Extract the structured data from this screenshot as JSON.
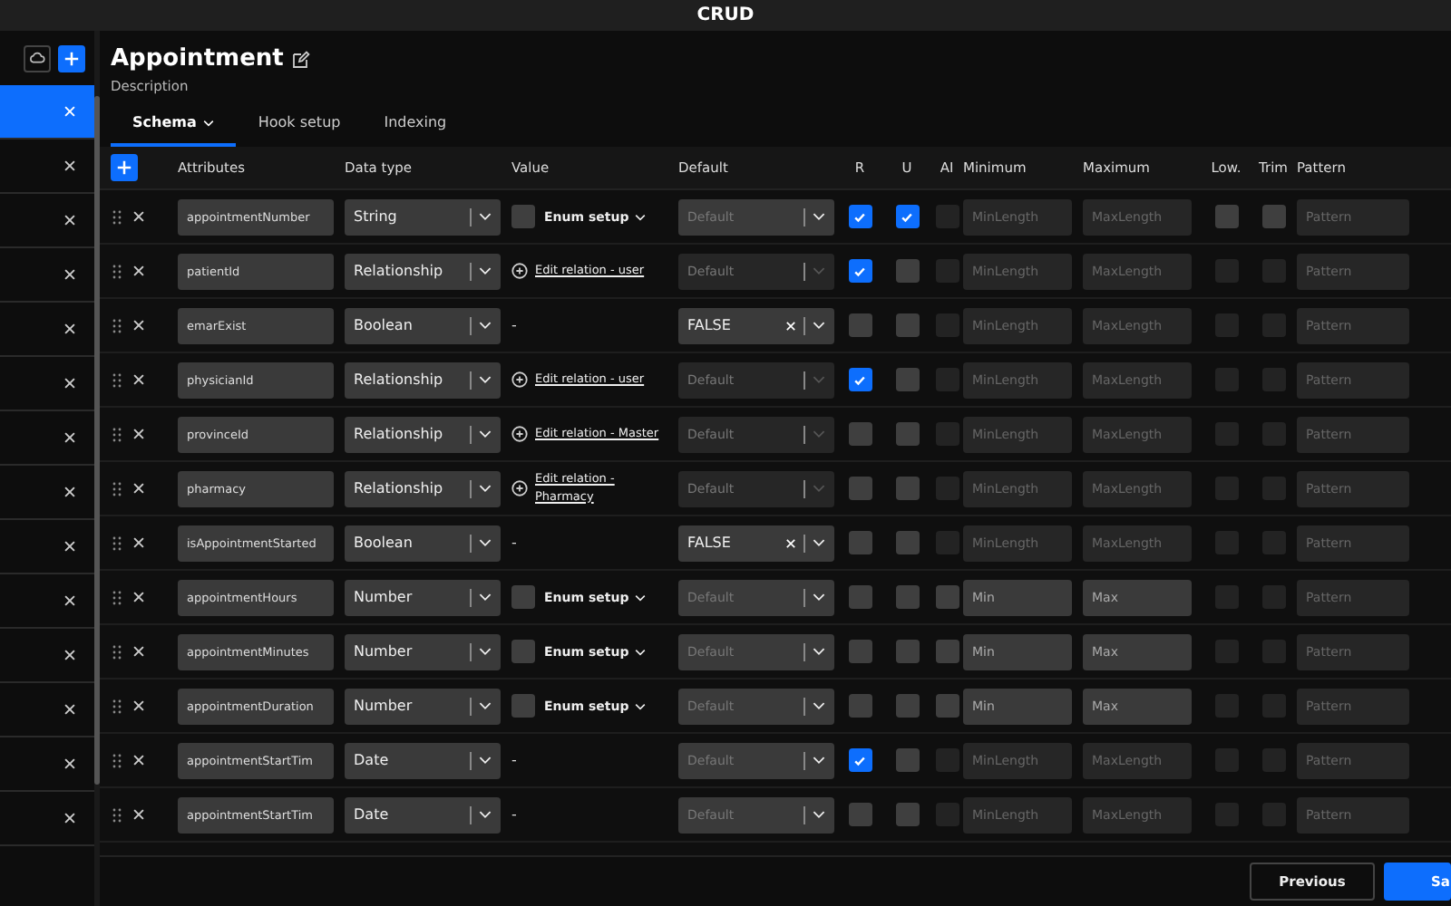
{
  "window": {
    "title": "CRUD"
  },
  "sidebar": {
    "items": [
      {
        "selected": true
      },
      {
        "selected": false
      },
      {
        "selected": false
      },
      {
        "selected": false
      },
      {
        "selected": false
      },
      {
        "selected": false
      },
      {
        "selected": false
      },
      {
        "selected": false
      },
      {
        "selected": false
      },
      {
        "selected": false
      },
      {
        "selected": false
      },
      {
        "selected": false
      },
      {
        "selected": false
      },
      {
        "selected": false
      }
    ]
  },
  "header": {
    "title": "Appointment",
    "description": "Description"
  },
  "tabs": [
    {
      "label": "Schema",
      "selected": true,
      "has_menu": true
    },
    {
      "label": "Hook setup",
      "selected": false,
      "has_menu": false
    },
    {
      "label": "Indexing",
      "selected": false,
      "has_menu": false
    }
  ],
  "table": {
    "columns": [
      "Attributes",
      "Data type",
      "Value",
      "Default",
      "R",
      "U",
      "AI",
      "Minimum",
      "Maximum",
      "Low.",
      "Trim",
      "Pattern"
    ],
    "rows": [
      {
        "name": "appointmentNumber",
        "type": "String",
        "value": {
          "kind": "enum",
          "text": "Enum setup",
          "checked": false
        },
        "default": {
          "kind": "placeholder",
          "text": "Default",
          "disabled": false
        },
        "r": {
          "checked": true,
          "disabled": false
        },
        "u": {
          "checked": true,
          "disabled": false
        },
        "ai": {
          "checked": false,
          "disabled": true
        },
        "min": {
          "placeholder": "MinLength",
          "disabled": true
        },
        "max": {
          "placeholder": "MaxLength",
          "disabled": true
        },
        "low": {
          "checked": false,
          "disabled": false
        },
        "trim": {
          "checked": false,
          "disabled": false
        },
        "pattern": {
          "placeholder": "Pattern"
        }
      },
      {
        "name": "patientId",
        "type": "Relationship",
        "value": {
          "kind": "relation",
          "text": "Edit relation - user"
        },
        "default": {
          "kind": "placeholder",
          "text": "Default",
          "disabled": true
        },
        "r": {
          "checked": true,
          "disabled": false
        },
        "u": {
          "checked": false,
          "disabled": false
        },
        "ai": {
          "checked": false,
          "disabled": true
        },
        "min": {
          "placeholder": "MinLength",
          "disabled": true
        },
        "max": {
          "placeholder": "MaxLength",
          "disabled": true
        },
        "low": {
          "checked": false,
          "disabled": true
        },
        "trim": {
          "checked": false,
          "disabled": true
        },
        "pattern": {
          "placeholder": "Pattern"
        }
      },
      {
        "name": "emarExist",
        "type": "Boolean",
        "value": {
          "kind": "none",
          "text": "-"
        },
        "default": {
          "kind": "value",
          "text": "FALSE",
          "disabled": false
        },
        "r": {
          "checked": false,
          "disabled": false
        },
        "u": {
          "checked": false,
          "disabled": false
        },
        "ai": {
          "checked": false,
          "disabled": true
        },
        "min": {
          "placeholder": "MinLength",
          "disabled": true
        },
        "max": {
          "placeholder": "MaxLength",
          "disabled": true
        },
        "low": {
          "checked": false,
          "disabled": true
        },
        "trim": {
          "checked": false,
          "disabled": true
        },
        "pattern": {
          "placeholder": "Pattern"
        }
      },
      {
        "name": "physicianId",
        "type": "Relationship",
        "value": {
          "kind": "relation",
          "text": "Edit relation - user"
        },
        "default": {
          "kind": "placeholder",
          "text": "Default",
          "disabled": true
        },
        "r": {
          "checked": true,
          "disabled": false
        },
        "u": {
          "checked": false,
          "disabled": false
        },
        "ai": {
          "checked": false,
          "disabled": true
        },
        "min": {
          "placeholder": "MinLength",
          "disabled": true
        },
        "max": {
          "placeholder": "MaxLength",
          "disabled": true
        },
        "low": {
          "checked": false,
          "disabled": true
        },
        "trim": {
          "checked": false,
          "disabled": true
        },
        "pattern": {
          "placeholder": "Pattern"
        }
      },
      {
        "name": "provinceId",
        "type": "Relationship",
        "value": {
          "kind": "relation",
          "text": "Edit relation - Master"
        },
        "default": {
          "kind": "placeholder",
          "text": "Default",
          "disabled": true
        },
        "r": {
          "checked": false,
          "disabled": false
        },
        "u": {
          "checked": false,
          "disabled": false
        },
        "ai": {
          "checked": false,
          "disabled": true
        },
        "min": {
          "placeholder": "MinLength",
          "disabled": true
        },
        "max": {
          "placeholder": "MaxLength",
          "disabled": true
        },
        "low": {
          "checked": false,
          "disabled": true
        },
        "trim": {
          "checked": false,
          "disabled": true
        },
        "pattern": {
          "placeholder": "Pattern"
        }
      },
      {
        "name": "pharmacy",
        "type": "Relationship",
        "value": {
          "kind": "relation",
          "text": "Edit relation - Pharmacy"
        },
        "default": {
          "kind": "placeholder",
          "text": "Default",
          "disabled": true
        },
        "r": {
          "checked": false,
          "disabled": false
        },
        "u": {
          "checked": false,
          "disabled": false
        },
        "ai": {
          "checked": false,
          "disabled": true
        },
        "min": {
          "placeholder": "MinLength",
          "disabled": true
        },
        "max": {
          "placeholder": "MaxLength",
          "disabled": true
        },
        "low": {
          "checked": false,
          "disabled": true
        },
        "trim": {
          "checked": false,
          "disabled": true
        },
        "pattern": {
          "placeholder": "Pattern"
        }
      },
      {
        "name": "isAppointmentStarted",
        "type": "Boolean",
        "value": {
          "kind": "none",
          "text": "-"
        },
        "default": {
          "kind": "value",
          "text": "FALSE",
          "disabled": false
        },
        "r": {
          "checked": false,
          "disabled": false
        },
        "u": {
          "checked": false,
          "disabled": false
        },
        "ai": {
          "checked": false,
          "disabled": true
        },
        "min": {
          "placeholder": "MinLength",
          "disabled": true
        },
        "max": {
          "placeholder": "MaxLength",
          "disabled": true
        },
        "low": {
          "checked": false,
          "disabled": true
        },
        "trim": {
          "checked": false,
          "disabled": true
        },
        "pattern": {
          "placeholder": "Pattern"
        }
      },
      {
        "name": "appointmentHours",
        "type": "Number",
        "value": {
          "kind": "enum",
          "text": "Enum setup",
          "checked": false
        },
        "default": {
          "kind": "placeholder",
          "text": "Default",
          "disabled": false
        },
        "r": {
          "checked": false,
          "disabled": false
        },
        "u": {
          "checked": false,
          "disabled": false
        },
        "ai": {
          "checked": false,
          "disabled": false
        },
        "min": {
          "placeholder": "Min",
          "disabled": false
        },
        "max": {
          "placeholder": "Max",
          "disabled": false
        },
        "low": {
          "checked": false,
          "disabled": true
        },
        "trim": {
          "checked": false,
          "disabled": true
        },
        "pattern": {
          "placeholder": "Pattern"
        }
      },
      {
        "name": "appointmentMinutes",
        "type": "Number",
        "value": {
          "kind": "enum",
          "text": "Enum setup",
          "checked": false
        },
        "default": {
          "kind": "placeholder",
          "text": "Default",
          "disabled": false
        },
        "r": {
          "checked": false,
          "disabled": false
        },
        "u": {
          "checked": false,
          "disabled": false
        },
        "ai": {
          "checked": false,
          "disabled": false
        },
        "min": {
          "placeholder": "Min",
          "disabled": false
        },
        "max": {
          "placeholder": "Max",
          "disabled": false
        },
        "low": {
          "checked": false,
          "disabled": true
        },
        "trim": {
          "checked": false,
          "disabled": true
        },
        "pattern": {
          "placeholder": "Pattern"
        }
      },
      {
        "name": "appointmentDuration",
        "type": "Number",
        "value": {
          "kind": "enum",
          "text": "Enum setup",
          "checked": false
        },
        "default": {
          "kind": "placeholder",
          "text": "Default",
          "disabled": false
        },
        "r": {
          "checked": false,
          "disabled": false
        },
        "u": {
          "checked": false,
          "disabled": false
        },
        "ai": {
          "checked": false,
          "disabled": false
        },
        "min": {
          "placeholder": "Min",
          "disabled": false
        },
        "max": {
          "placeholder": "Max",
          "disabled": false
        },
        "low": {
          "checked": false,
          "disabled": true
        },
        "trim": {
          "checked": false,
          "disabled": true
        },
        "pattern": {
          "placeholder": "Pattern"
        }
      },
      {
        "name": "appointmentStartTim",
        "type": "Date",
        "value": {
          "kind": "none",
          "text": "-"
        },
        "default": {
          "kind": "placeholder",
          "text": "Default",
          "disabled": false
        },
        "r": {
          "checked": true,
          "disabled": false
        },
        "u": {
          "checked": false,
          "disabled": false
        },
        "ai": {
          "checked": false,
          "disabled": true
        },
        "min": {
          "placeholder": "MinLength",
          "disabled": true
        },
        "max": {
          "placeholder": "MaxLength",
          "disabled": true
        },
        "low": {
          "checked": false,
          "disabled": true
        },
        "trim": {
          "checked": false,
          "disabled": true
        },
        "pattern": {
          "placeholder": "Pattern"
        }
      },
      {
        "name": "appointmentStartTim",
        "type": "Date",
        "value": {
          "kind": "none",
          "text": "-"
        },
        "default": {
          "kind": "placeholder",
          "text": "Default",
          "disabled": false
        },
        "r": {
          "checked": false,
          "disabled": false
        },
        "u": {
          "checked": false,
          "disabled": false
        },
        "ai": {
          "checked": false,
          "disabled": true
        },
        "min": {
          "placeholder": "MinLength",
          "disabled": true
        },
        "max": {
          "placeholder": "MaxLength",
          "disabled": true
        },
        "low": {
          "checked": false,
          "disabled": true
        },
        "trim": {
          "checked": false,
          "disabled": true
        },
        "pattern": {
          "placeholder": "Pattern"
        }
      }
    ]
  },
  "footer": {
    "buttons": [
      {
        "label": "Previous",
        "kind": "secondary"
      },
      {
        "label": "Sa",
        "kind": "primary"
      }
    ]
  }
}
